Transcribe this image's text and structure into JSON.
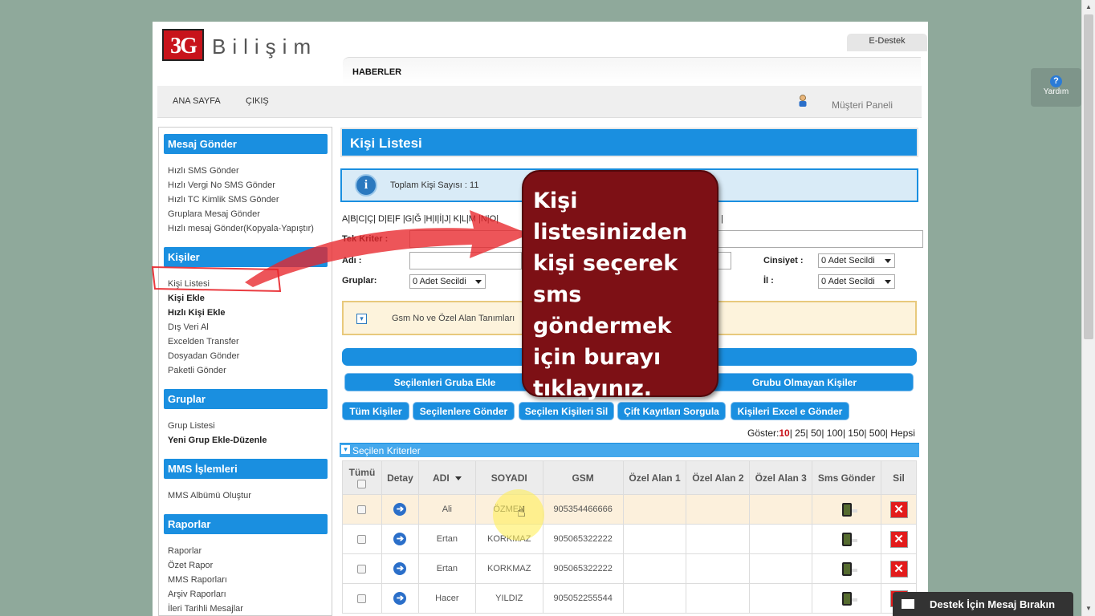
{
  "header": {
    "logo_mark": "3G",
    "logo_text": "Bilişim",
    "edestek_tab": "E-Destek",
    "news_label": "HABERLER",
    "nav": [
      "ANA SAYFA",
      "ÇIKIŞ"
    ],
    "customer_panel": "Müşteri Paneli"
  },
  "help_label": "Yardım",
  "sidebar": {
    "sections": [
      {
        "title": "Mesaj Gönder",
        "items": [
          "Hızlı SMS Gönder",
          "Hızlı Vergi No SMS Gönder",
          "Hızlı TC Kimlik SMS Gönder",
          "Gruplara Mesaj Gönder",
          "Hızlı mesaj Gönder(Kopyala-Yapıştır)"
        ]
      },
      {
        "title": "Kişiler",
        "items": [
          "Kişi Listesi",
          "Kişi Ekle",
          "Hızlı Kişi Ekle",
          "Dış Veri Al",
          "Excelden Transfer",
          "Dosyadan Gönder",
          "Paketli Gönder"
        ]
      },
      {
        "title": "Gruplar",
        "items": [
          "Grup Listesi",
          "Yeni Grup Ekle-Düzenle"
        ]
      },
      {
        "title": "MMS İşlemleri",
        "items": [
          "MMS Albümü Oluştur"
        ]
      },
      {
        "title": "Raporlar",
        "items": [
          "Raporlar",
          "Özet Rapor",
          "MMS Raporları",
          "Arşiv Raporları",
          "İleri Tarihli Mesajlar"
        ]
      }
    ]
  },
  "main": {
    "title": "Kişi Listesi",
    "info": "Toplam Kişi Sayısı : 11",
    "alphabet": "A|B|C|Ç| D|E|F |G|Ğ |H|I|İ|J| K|L|M |N|O|",
    "alphabet_tail": "|",
    "filters": {
      "single_criteria": "Tek Kriter :",
      "name": "Adı :",
      "groups": "Gruplar:",
      "groups_value": "0 Adet Secildi",
      "gender": "Cinsiyet :",
      "gender_value": "0 Adet Secildi",
      "city": "İl :",
      "city_value": "0 Adet Secildi"
    },
    "gsm_definitions": "Gsm No ve Özel Alan Tanımları",
    "row_buttons": [
      "Seçilenleri Gruba Ekle",
      "Grubu Olmayan Kişiler"
    ],
    "action_buttons": [
      "Tüm Kişiler",
      "Seçilenlere Gönder",
      "Seçilen Kişileri Sil",
      "Çift Kayıtları Sorgula",
      "Kişileri Excel e Gönder"
    ],
    "show": {
      "label": "Göster:",
      "options": [
        "10",
        "25",
        "50",
        "100",
        "150",
        "500",
        "Hepsi"
      ],
      "active": "10"
    },
    "criteria_label": "Seçilen Kriterler",
    "table": {
      "headers": [
        "Tümü",
        "Detay",
        "ADI",
        "SOYADI",
        "GSM",
        "Özel Alan 1",
        "Özel Alan 2",
        "Özel Alan 3",
        "Sms Gönder",
        "Sil"
      ],
      "rows": [
        {
          "name": "Ali",
          "surname": "ÖZMEN",
          "gsm": "905354466666"
        },
        {
          "name": "Ertan",
          "surname": "KORKMAZ",
          "gsm": "905065322222"
        },
        {
          "name": "Ertan",
          "surname": "KORKMAZ",
          "gsm": "905065322222"
        },
        {
          "name": "Hacer",
          "surname": "YILDIZ",
          "gsm": "905052255544"
        }
      ]
    }
  },
  "callout": "Kişi listesinizden kişi seçerek sms göndermek için burayı tıklayınız.",
  "chat_label": "Destek İçin Mesaj Bırakın",
  "colors": {
    "accent": "#1a8fe0",
    "callout": "#7d1015",
    "background": "#8fa99b",
    "annotation": "#e8252a"
  }
}
